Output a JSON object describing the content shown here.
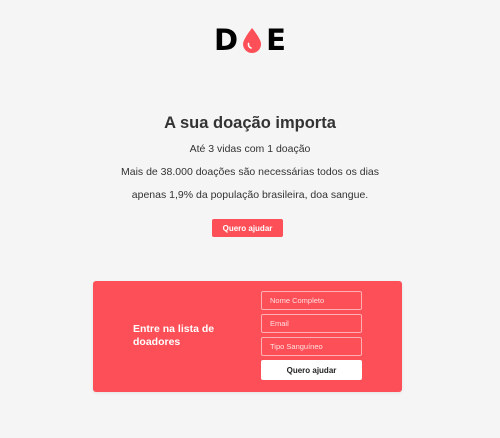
{
  "logo": {
    "letter_left": "D",
    "letter_right": "E",
    "drop_color": "#fd4f57",
    "drop_icon": "blood-drop-icon"
  },
  "hero": {
    "title": "A sua doação importa",
    "lines": [
      "Até 3 vidas com 1 doação",
      "Mais de 38.000 doações são necessárias todos os dias",
      "apenas 1,9% da população brasileira, doa sangue."
    ],
    "cta_label": "Quero ajudar"
  },
  "signup": {
    "heading": "Entre na lista de doadores",
    "fields": {
      "name_placeholder": "Nome Completo",
      "email_placeholder": "Email",
      "blood_type_placeholder": "Tipo Sanguíneo"
    },
    "submit_label": "Quero ajudar"
  },
  "colors": {
    "accent": "#fd4f57",
    "background": "#f5f5f5",
    "text": "#333333"
  }
}
